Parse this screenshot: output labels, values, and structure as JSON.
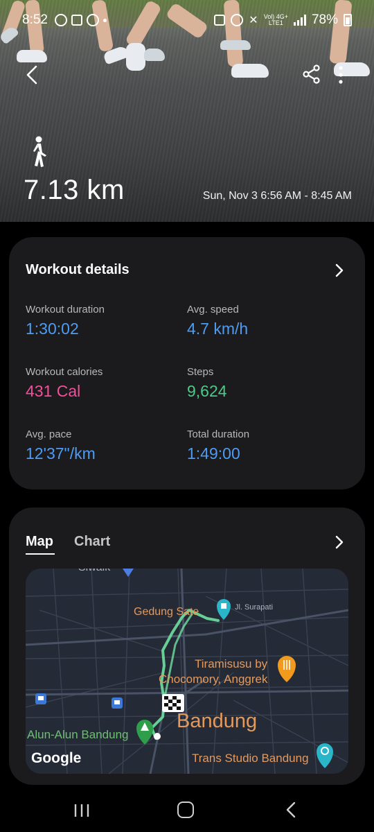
{
  "status_bar": {
    "time": "8:52",
    "network_top": "Vol) 4G+",
    "network_bottom": "LTE1",
    "battery": "78%"
  },
  "header": {
    "activity_icon": "walking-person-icon",
    "distance": "7.13 km",
    "date_range": "Sun, Nov 3 6:56 AM - 8:45 AM"
  },
  "details": {
    "title": "Workout details",
    "metrics": [
      {
        "label": "Workout duration",
        "value": "1:30:02",
        "color": "#4e9cf2"
      },
      {
        "label": "Avg. speed",
        "value": "4.7 km/h",
        "color": "#4e9cf2"
      },
      {
        "label": "Workout calories",
        "value": "431 Cal",
        "color": "#f2509a"
      },
      {
        "label": "Steps",
        "value": "9,624",
        "color": "#4ec98a"
      },
      {
        "label": "Avg. pace",
        "value": "12'37\"/km",
        "color": "#4e9cf2"
      },
      {
        "label": "Total duration",
        "value": "1:49:00",
        "color": "#4e9cf2"
      }
    ]
  },
  "map_card": {
    "tabs": [
      "Map",
      "Chart"
    ],
    "active_tab": "Map",
    "labels": {
      "top_partial": "Siwalk",
      "gedung_sate": "Gedung Sate",
      "jl_surapati": "Jl. Surapati",
      "tiramisusu_line1": "Tiramisusu by",
      "tiramisusu_line2": "Chocomory, Anggrek",
      "bandung": "Bandung",
      "alun_alun": "Alun-Alun Bandung",
      "trans_studio": "Trans Studio Bandung",
      "google": "Google"
    }
  },
  "colors": {
    "card_bg": "#1b1b1d",
    "accent_blue": "#4e9cf2",
    "calories_pink": "#f2509a",
    "steps_green": "#4ec98a",
    "route_green": "#6fe0a0",
    "map_poi_orange": "#e39a5e"
  }
}
